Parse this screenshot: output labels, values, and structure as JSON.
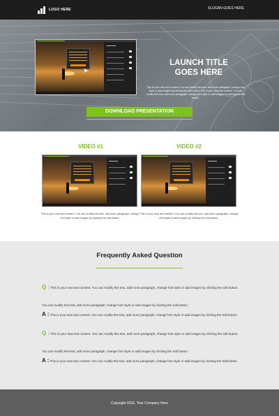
{
  "header": {
    "logo_text": "LOGO HERE",
    "slogan": "SLOGAN GOES HERE"
  },
  "hero": {
    "title_line1": "LAUNCH TITLE",
    "title_line2": "GOES HERE",
    "body": "This is your new text content. You can modify this text, add more paragraph, change font style or add images by clicking the edit button.This is your new text content. You can modify this text, add more paragraph, change font style or add images by clicking the edit button.",
    "download_label": "DOWNLOAD PRESENTATION"
  },
  "videos": [
    {
      "title": "VIDEO #1",
      "description": "This is your new text content. You can modify this text, add more paragraph, change font style or add images by clicking the edit button."
    },
    {
      "title": "VIDEO #2",
      "description": "This is your new text content. You can modify this text, add more paragraph, change font style or add images by clicking the edit button."
    }
  ],
  "faq": {
    "title": "Frequently Asked Question",
    "q_mark": "Q :",
    "a_mark": "A :",
    "items": [
      {
        "type": "q",
        "text": " This is your new text content. You can modify this text, add more paragraph, change font style or add images by clicking the edit button."
      },
      {
        "type": "plain",
        "text": "You can modify this text, add more paragraph, change font style or add images by clicking the edit button."
      },
      {
        "type": "a",
        "text": " This is your new text content. You can modify this text, add more paragraph, change font style or add images by clicking the edit button."
      },
      {
        "type": "q",
        "text": " This is your new text content. You can modify this text, add more paragraph, change font style or add images by clicking the edit button."
      },
      {
        "type": "plain",
        "text": "You can modify this text, add more paragraph, change font style or add images by clicking the edit button."
      },
      {
        "type": "a",
        "text": " This is your new text content. You can modify this text, add more paragraph, change font style or add images by clicking the edit button."
      }
    ]
  },
  "footer": {
    "copyright": "Copyright 2016. Your Company Here"
  },
  "colors": {
    "accent": "#7dc31f",
    "header_bg": "#1d1d1d",
    "footer_bg": "#5e5e5e",
    "faq_bg": "#e9e9e9"
  },
  "icons": [
    "logo-bars-icon",
    "play-icon"
  ]
}
